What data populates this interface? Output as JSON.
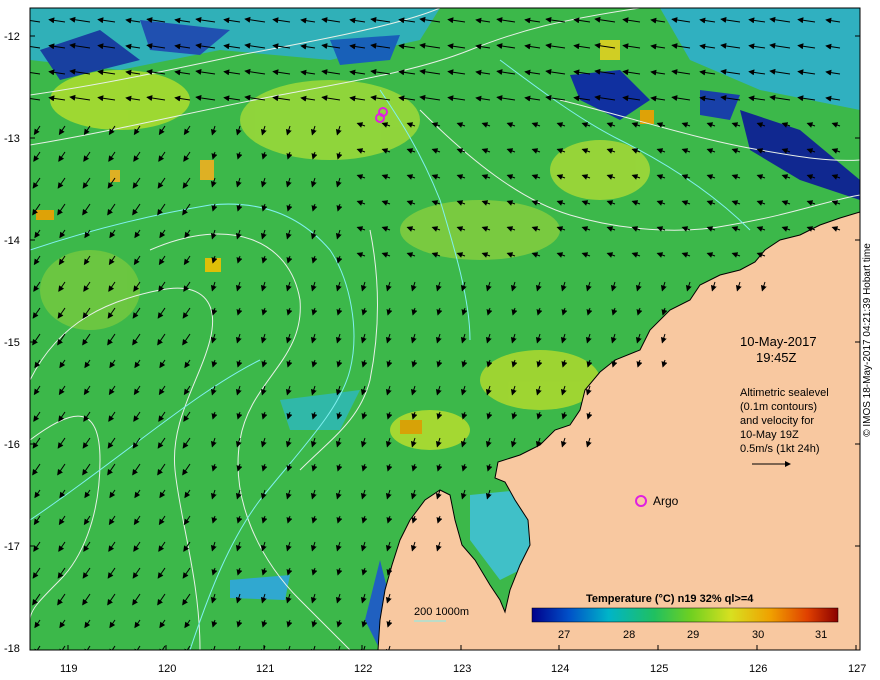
{
  "map": {
    "lat_labels": [
      "-12",
      "-13",
      "-14",
      "-15",
      "-16",
      "-17",
      "-18"
    ],
    "lon_labels": [
      "119",
      "120",
      "121",
      "122",
      "123",
      "124",
      "125",
      "126",
      "127"
    ]
  },
  "annotations": {
    "date": "10-May-2017",
    "time": "19:45Z",
    "altimetry_lines": [
      "Altimetric sealevel",
      "(0.1m contours)",
      "and velocity for",
      "10-May 19Z",
      "0.5m/s (1kt 24h)"
    ],
    "argo_label": "Argo",
    "bathymetry_label": "200  1000m"
  },
  "colorbar": {
    "title": "Temperature (°C) n19 32% ql>=4",
    "ticks": [
      "27",
      "28",
      "29",
      "30",
      "31"
    ],
    "colors": [
      "#00008b",
      "#0050c8",
      "#00b4c8",
      "#20c060",
      "#70d020",
      "#d8e020",
      "#f0a000",
      "#e04000",
      "#8b0000"
    ]
  },
  "credit": "© IMOS 18-May-2017 04:21:39 Hobart time",
  "colors": {
    "ocean": "#3cb84a",
    "land": "#f8c8a0",
    "contour": "#e8f0e8",
    "isobath": "#80f0f0",
    "argo": "#e020e0"
  }
}
